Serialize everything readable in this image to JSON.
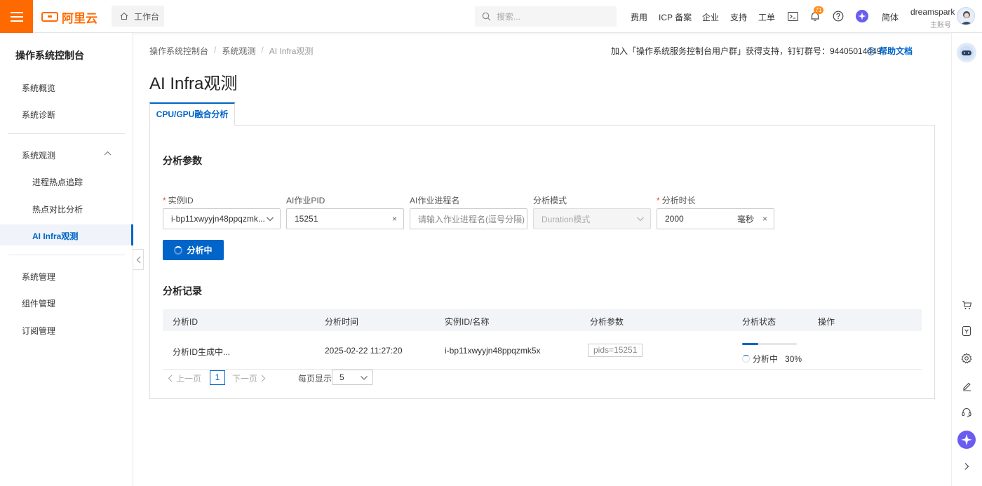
{
  "topbar": {
    "brand": "阿里云",
    "workbench": "工作台",
    "search_placeholder": "搜索...",
    "nav": [
      "费用",
      "ICP 备案",
      "企业",
      "支持",
      "工单"
    ],
    "notification_count": "71",
    "language": "简体",
    "user_name": "dreamspark",
    "user_role": "主账号"
  },
  "sidebar": {
    "title": "操作系统控制台",
    "items": {
      "overview": "系统概览",
      "diagnosis": "系统诊断",
      "observe": "系统观测",
      "hotspot": "进程热点追踪",
      "compare": "热点对比分析",
      "ai_infra": "AI Infra观测",
      "manage": "系统管理",
      "components": "组件管理",
      "subscribe": "订阅管理"
    }
  },
  "breadcrumb": [
    "操作系统控制台",
    "系统观测",
    "AI Infra观测"
  ],
  "help": {
    "text": "加入「操作系统服务控制台用户群」获得支持，钉钉群号：94405014449",
    "doc": "帮助文档"
  },
  "page_title": "AI Infra观测",
  "tab": "CPU/GPU融合分析",
  "params": {
    "title": "分析参数",
    "instance_label": "实例ID",
    "instance_value": "i-bp11xwyyjn48ppqzmk...",
    "pid_label": "AI作业PID",
    "pid_value": "15251",
    "proc_label": "AI作业进程名",
    "proc_placeholder": "请输入作业进程名(逗号分隔)",
    "mode_label": "分析模式",
    "mode_value": "Duration模式",
    "duration_label": "分析时长",
    "duration_value": "2000",
    "duration_unit": "毫秒",
    "button": "分析中"
  },
  "records": {
    "title": "分析记录",
    "columns": [
      "分析ID",
      "分析时间",
      "实例ID/名称",
      "分析参数",
      "分析状态",
      "操作"
    ],
    "rows": [
      {
        "id": "分析ID生成中...",
        "time": "2025-02-22 11:27:20",
        "instance": "i-bp11xwyyjn48ppqzmk5x",
        "params": "pids=15251",
        "status": "分析中",
        "progress_text": "30%",
        "progress": 0.3
      }
    ]
  },
  "pagination": {
    "prev": "上一页",
    "current": "1",
    "next": "下一页",
    "size_label": "每页显示",
    "size": "5"
  }
}
